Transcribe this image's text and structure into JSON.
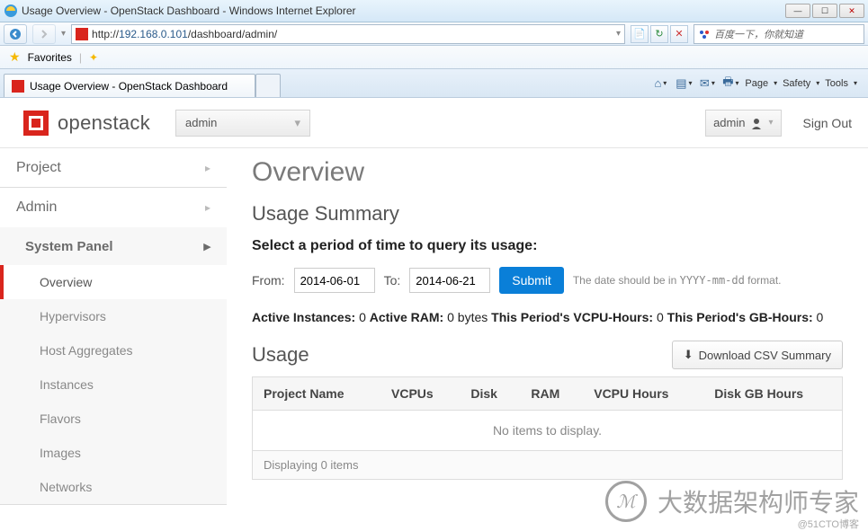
{
  "browser": {
    "window_title": "Usage Overview - OpenStack Dashboard - Windows Internet Explorer",
    "url_prefix": "http://",
    "url_host": "192.168.0.101",
    "url_path": "/dashboard/admin/",
    "search_placeholder": "百度一下，你就知道",
    "favorites_label": "Favorites",
    "tab_title": "Usage Overview - OpenStack Dashboard",
    "cmd": {
      "page": "Page",
      "safety": "Safety",
      "tools": "Tools"
    }
  },
  "header": {
    "brand": "openstack",
    "tenant": "admin",
    "user": "admin",
    "signout": "Sign Out"
  },
  "sidebar": {
    "project": "Project",
    "admin": "Admin",
    "system_panel": "System Panel",
    "items": [
      "Overview",
      "Hypervisors",
      "Host Aggregates",
      "Instances",
      "Flavors",
      "Images",
      "Networks"
    ]
  },
  "main": {
    "title": "Overview",
    "summary": "Usage Summary",
    "query_label": "Select a period of time to query its usage:",
    "from_label": "From:",
    "to_label": "To:",
    "from_value": "2014-06-01",
    "to_value": "2014-06-21",
    "submit": "Submit",
    "hint_prefix": "The date should be in ",
    "hint_fmt": "YYYY-mm-dd",
    "hint_suffix": " format.",
    "stats": {
      "ai_label": "Active Instances:",
      "ai_val": "0",
      "ar_label": "Active RAM:",
      "ar_val": "0 bytes",
      "vh_label": "This Period's VCPU-Hours:",
      "vh_val": "0",
      "gh_label": "This Period's GB-Hours:",
      "gh_val": "0"
    },
    "usage_title": "Usage",
    "download": "Download CSV Summary",
    "cols": [
      "Project Name",
      "VCPUs",
      "Disk",
      "RAM",
      "VCPU Hours",
      "Disk GB Hours"
    ],
    "empty": "No items to display.",
    "footer": "Displaying 0 items"
  },
  "watermark": {
    "text": "大数据架构师专家",
    "sub": "@51CTO博客"
  }
}
